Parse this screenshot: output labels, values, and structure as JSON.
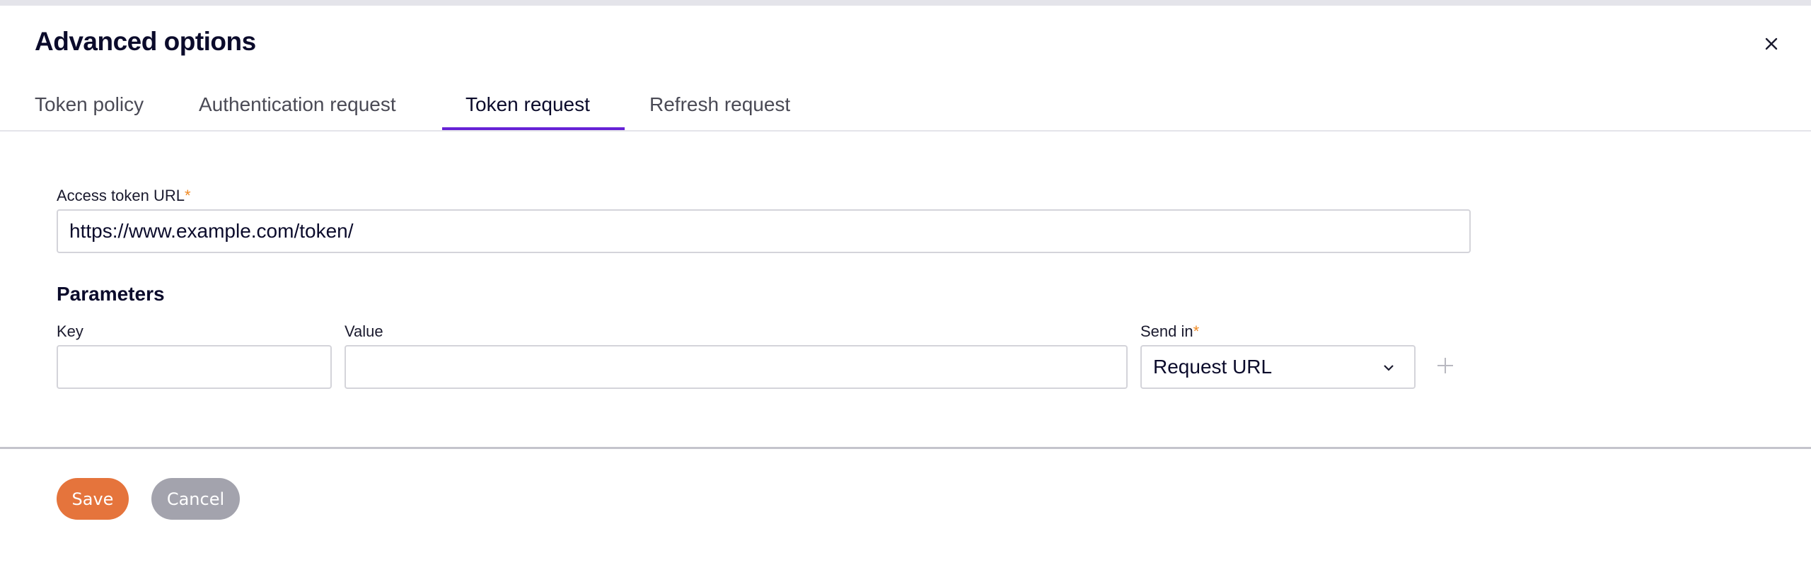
{
  "dialog": {
    "title": "Advanced options",
    "close_icon": "close-icon"
  },
  "tabs": [
    {
      "label": "Token policy",
      "active": false
    },
    {
      "label": "Authentication request",
      "active": false
    },
    {
      "label": "Token request",
      "active": true
    },
    {
      "label": "Refresh request",
      "active": false
    }
  ],
  "form": {
    "access_token_url": {
      "label": "Access token URL",
      "required_mark": "*",
      "value": "https://www.example.com/token/"
    },
    "parameters": {
      "title": "Parameters",
      "key_label": "Key",
      "key_value": "",
      "value_label": "Value",
      "value_value": "",
      "send_in_label": "Send in",
      "send_in_required_mark": "*",
      "send_in_selected": "Request URL",
      "add_icon": "plus-icon"
    }
  },
  "footer": {
    "save_label": "Save",
    "cancel_label": "Cancel"
  },
  "colors": {
    "accent": "#6622d6",
    "save": "#e5743c",
    "cancel": "#a3a3ad",
    "required": "#f08a24"
  }
}
